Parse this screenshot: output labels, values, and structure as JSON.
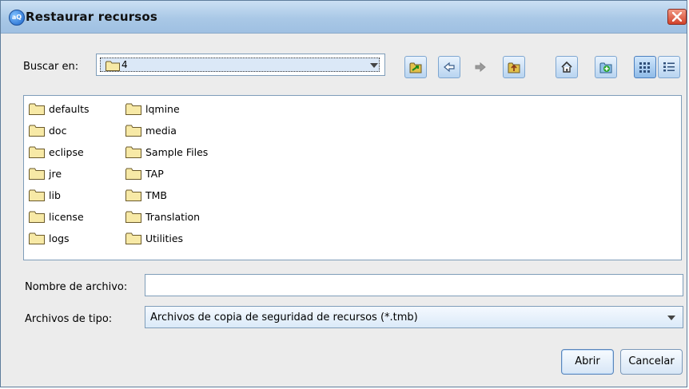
{
  "window": {
    "title": "Restaurar recursos",
    "app_icon_text": "aQ"
  },
  "toolbar": {
    "look_in_label": "Buscar en:",
    "look_in_value": "4",
    "buttons": [
      "go-to-folder-icon",
      "back-icon",
      "forward-icon",
      "up-one-level-icon",
      "home-icon",
      "new-folder-icon",
      "list-view-icon",
      "details-view-icon"
    ]
  },
  "files": {
    "column1": [
      "defaults",
      "doc",
      "eclipse",
      "jre",
      "lib",
      "license",
      "logs"
    ],
    "column2": [
      "lqmine",
      "media",
      "Sample Files",
      "TAP",
      "TMB",
      "Translation",
      "Utilities"
    ]
  },
  "form": {
    "filename_label": "Nombre de archivo:",
    "filename_value": "",
    "filetype_label": "Archivos de tipo:",
    "filetype_value": "Archivos de copia de seguridad de recursos (*.tmb)"
  },
  "actions": {
    "open_label": "Abrir",
    "cancel_label": "Cancelar"
  },
  "colors": {
    "title_gradient": "#a9c8e6",
    "close": "#d2432c",
    "folder_fill": "#f7e9a6"
  }
}
